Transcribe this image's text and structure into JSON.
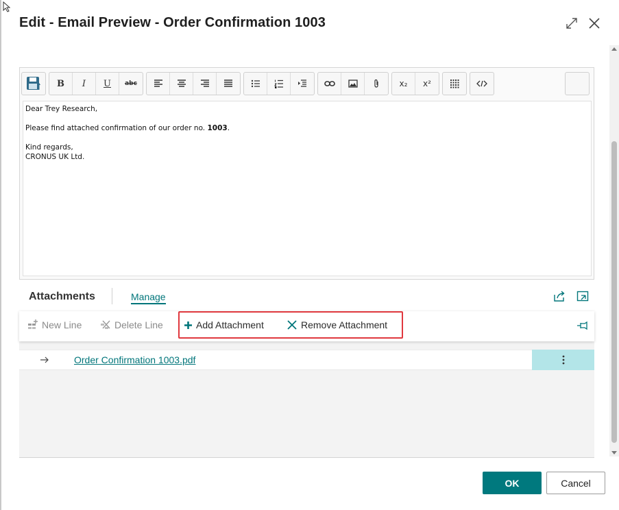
{
  "dialog": {
    "title": "Edit - Email Preview - Order Confirmation 1003",
    "expand_icon": "expand-icon",
    "close_icon": "close-icon"
  },
  "editor": {
    "toolbar": {
      "save_icon": "save-icon",
      "buttons": [
        "B",
        "I",
        "U",
        "abc",
        "x₂",
        "x²"
      ]
    },
    "body": {
      "greeting": "Dear Trey Research,",
      "line_prefix": "Please find attached confirmation of our order no. ",
      "order_no": "1003",
      "line_suffix": ".",
      "closing": "Kind regards,",
      "signature": "CRONUS UK Ltd."
    }
  },
  "attachments": {
    "title": "Attachments",
    "manage_label": "Manage",
    "actions": {
      "new_line": "New Line",
      "delete_line": "Delete Line",
      "add_attachment": "Add Attachment",
      "remove_attachment": "Remove Attachment"
    },
    "rows": [
      {
        "file_name": "Order Confirmation 1003.pdf"
      }
    ]
  },
  "footer": {
    "ok_label": "OK",
    "cancel_label": "Cancel"
  },
  "colors": {
    "accent": "#00797e",
    "link": "#00757a",
    "highlight_border": "#e0383e",
    "row_selected": "#b3e5e8"
  }
}
